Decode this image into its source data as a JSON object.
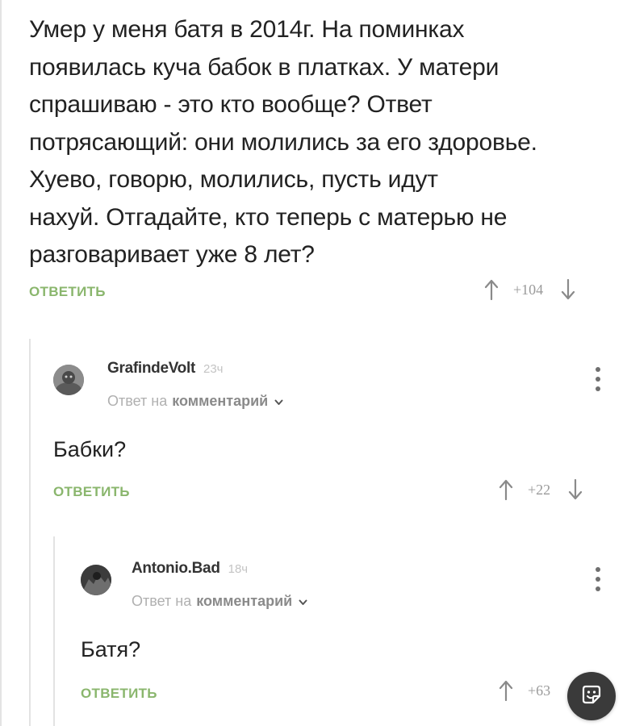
{
  "root_comment": {
    "text": "Умер у меня батя в 2014г. На поминках\nпоявилась куча бабок в платках. У матери\nспрашиваю - это кто вообще? Ответ\nпотрясающий: они молились за его здоровье.\nХуево, говорю, молились, пусть идут\nнахуй. Отгадайте, кто теперь с матерью не\nразговаривает уже 8 лет?",
    "reply_label": "ОТВЕТИТЬ",
    "score": "+104"
  },
  "reply_1": {
    "author": "GrafindeVolt",
    "time": "23ч",
    "reply_prefix": "Ответ на",
    "reply_target": "комментарий",
    "text": "Бабки?",
    "reply_label": "ОТВЕТИТЬ",
    "score": "+22"
  },
  "reply_2": {
    "author": "Antonio.Bad",
    "time": "18ч",
    "reply_prefix": "Ответ на",
    "reply_target": "комментарий",
    "text": "Батя?",
    "reply_label": "ОТВЕТИТЬ",
    "score": "+63"
  },
  "icons": {
    "upvote": "arrow-up-icon",
    "downvote": "arrow-down-icon",
    "more": "more-vertical-icon",
    "expand": "chevron-down-icon",
    "fab": "sticker-icon"
  },
  "colors": {
    "reply_link": "#8ab66d",
    "text": "#222222",
    "muted": "#9a9a9a",
    "fab_bg": "#3a3a3a"
  }
}
